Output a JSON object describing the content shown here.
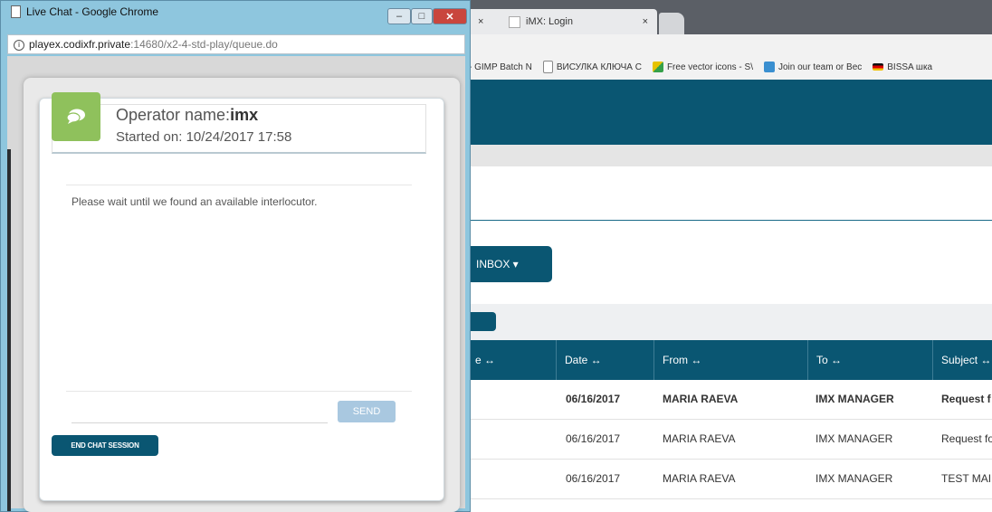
{
  "colors": {
    "accent": "#0a5672",
    "chat_green": "#8fc15c",
    "send_button": "#a9c8e0",
    "popup_frame": "#8ec6de"
  },
  "browser": {
    "tabs": [
      {
        "label": "×"
      },
      {
        "label": "iMX: Login",
        "close": "×"
      }
    ],
    "bookmarks": [
      {
        "label": "- GIMP Batch N",
        "icon": "page-icon"
      },
      {
        "label": "ВИСУЛКА КЛЮЧА С",
        "icon": "page-icon"
      },
      {
        "label": "Free vector icons - S\\",
        "icon": "vector-icon"
      },
      {
        "label": "Join our team or Bec",
        "icon": "image-icon"
      },
      {
        "label": "BISSA шка",
        "icon": "flag-icon"
      }
    ]
  },
  "app": {
    "inbox_label": "INBOX ▾",
    "table": {
      "headers": [
        "e ↔",
        "Date ↔",
        "From ↔",
        "To ↔",
        "Subject ↔"
      ],
      "rows": [
        {
          "date": "06/16/2017",
          "from": "MARIA RAEVA",
          "to": "IMX MANAGER",
          "subject": "Request f",
          "bold": true
        },
        {
          "date": "06/16/2017",
          "from": "MARIA RAEVA",
          "to": "IMX MANAGER",
          "subject": "Request fo",
          "bold": false
        },
        {
          "date": "06/16/2017",
          "from": "MARIA RAEVA",
          "to": "IMX MANAGER",
          "subject": "TEST MAI",
          "bold": false
        }
      ]
    }
  },
  "popup": {
    "window_title": "Live Chat - Google Chrome",
    "window_buttons": {
      "minimize": "–",
      "maximize": "□",
      "close": "✕"
    },
    "url_host": "playex.codixfr.private",
    "url_path": ":14680/x2-4-std-play/queue.do",
    "chat": {
      "operator_label": "Operator name:",
      "operator_name": "imx",
      "started_label": "Started on:",
      "started_value": "10/24/2017 17:58",
      "wait_message": "Please wait until we found an available interlocutor.",
      "input_value": "",
      "send_label": "SEND",
      "end_label": "END CHAT SESSION"
    }
  }
}
